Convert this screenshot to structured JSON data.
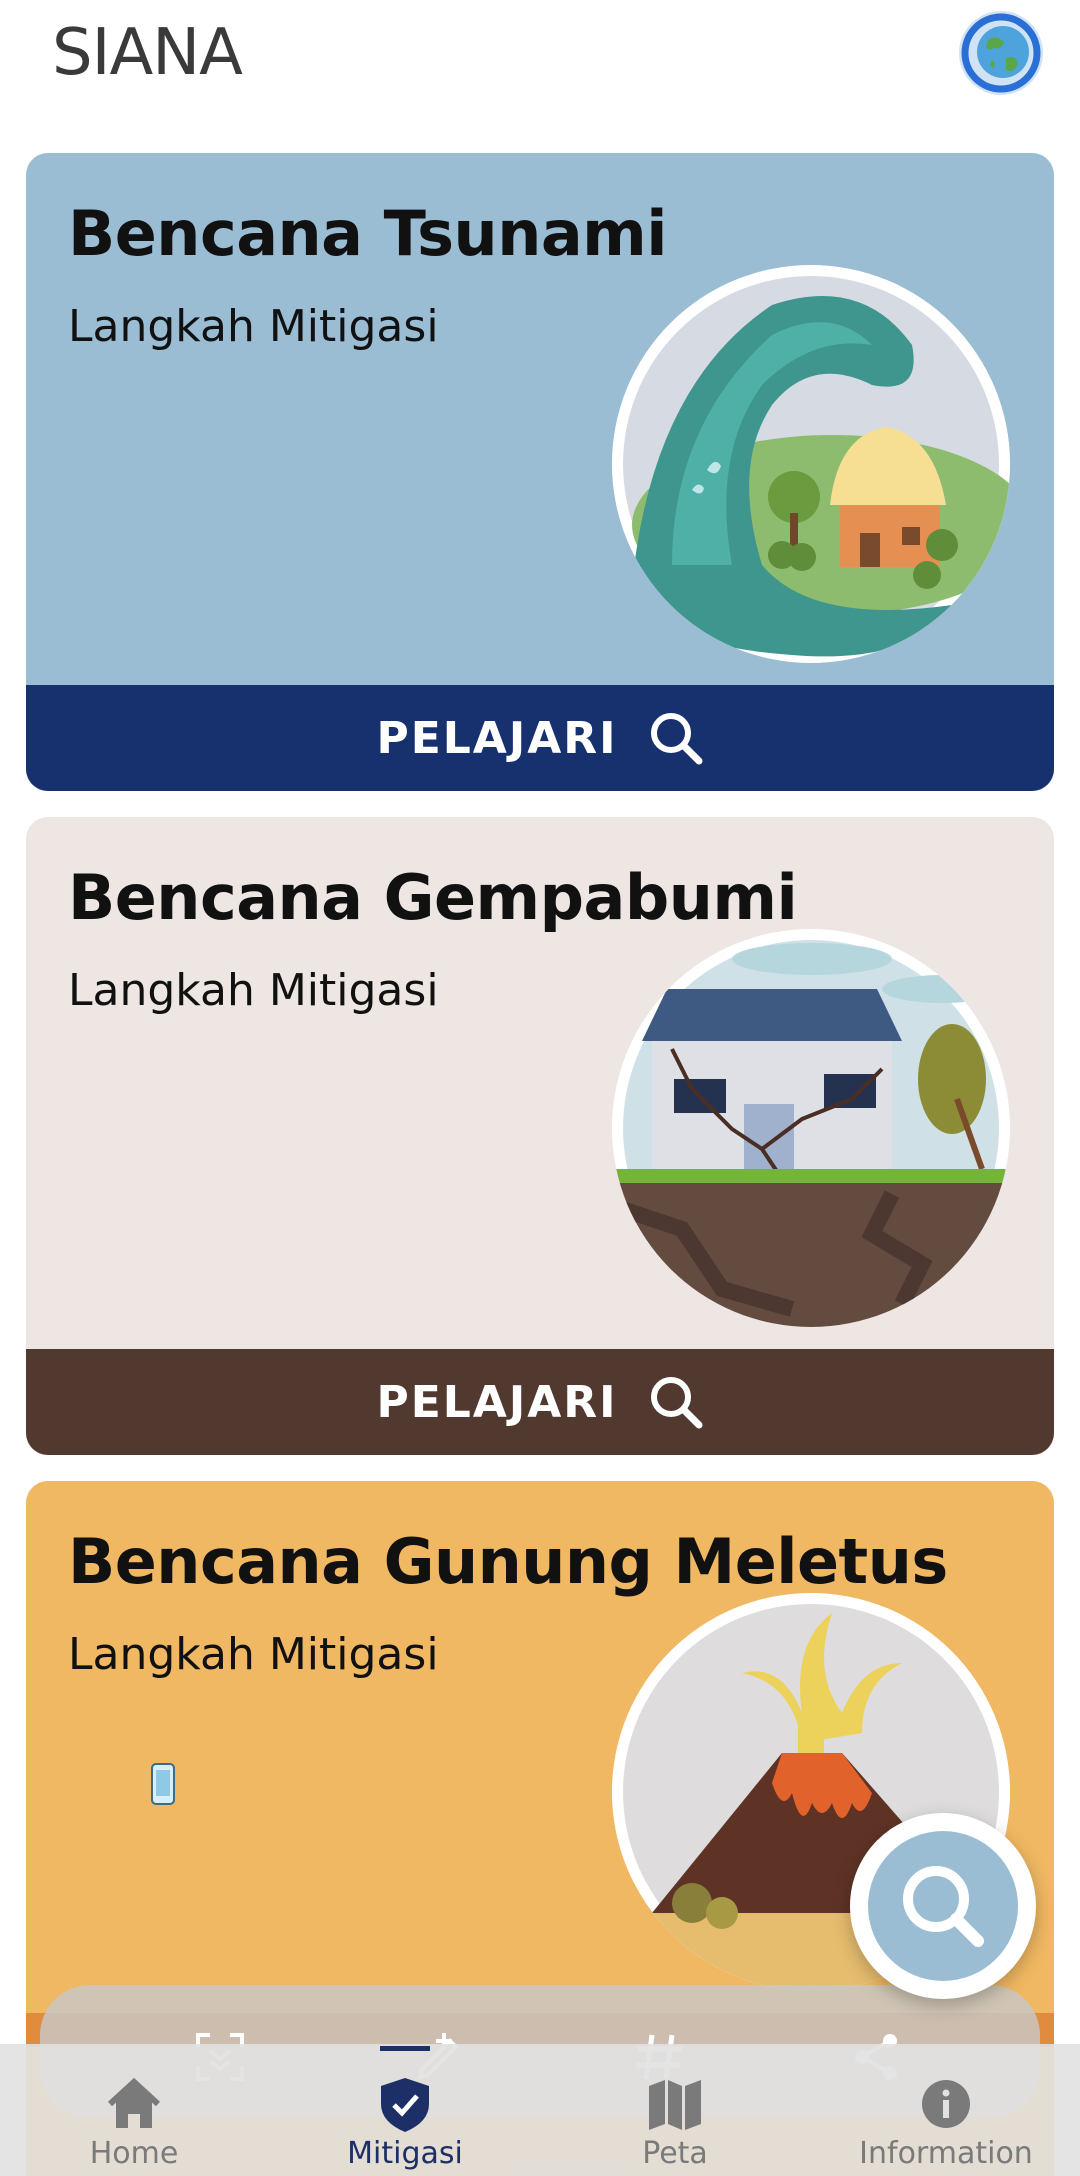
{
  "app": {
    "title": "SIANA"
  },
  "header": {
    "globe_icon": "globe-icon"
  },
  "cards": [
    {
      "title": "Bencana Tsunami",
      "subtitle": "Langkah Mitigasi",
      "action_label": "PELAJARI",
      "illustration": "tsunami-wave-house",
      "bg": "#9bbdd4",
      "action_bg": "#16316e"
    },
    {
      "title": "Bencana Gempabumi",
      "subtitle": "Langkah Mitigasi",
      "action_label": "PELAJARI",
      "illustration": "earthquake-cracked-house",
      "bg": "#ede6e2",
      "action_bg": "#52392f"
    },
    {
      "title": "Bencana Gunung Meletus",
      "subtitle": "Langkah Mitigasi",
      "illustration": "erupting-volcano",
      "bg": "#f0b862"
    }
  ],
  "fab": {
    "icon": "search-icon",
    "bg": "#9bbdd4"
  },
  "bottom_nav": {
    "items": [
      {
        "label": "Home",
        "icon": "home-icon",
        "active": false
      },
      {
        "label": "Mitigasi",
        "icon": "shield-check-icon",
        "active": true
      },
      {
        "label": "Peta",
        "icon": "map-icon",
        "active": false
      },
      {
        "label": "Information",
        "icon": "info-icon",
        "active": false
      }
    ],
    "active_color": "#1c2f66",
    "inactive_color": "#7a7a7a"
  }
}
